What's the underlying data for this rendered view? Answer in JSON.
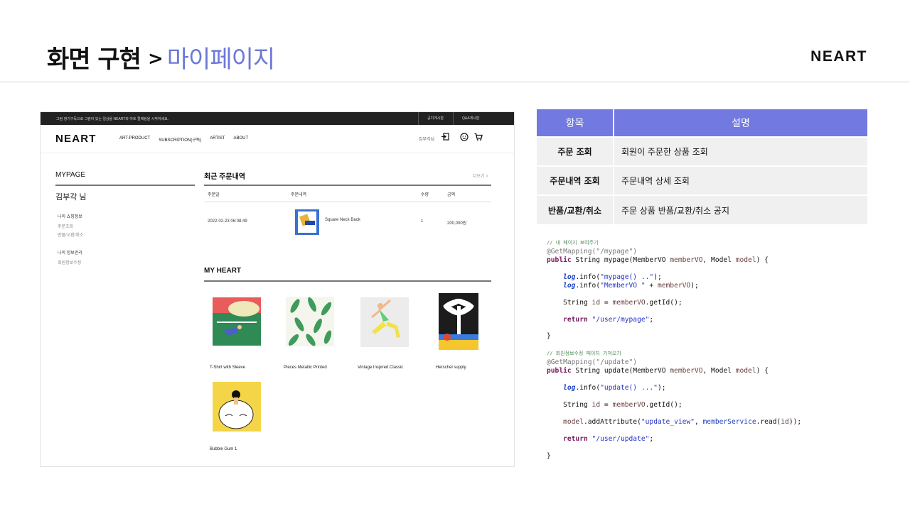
{
  "slide": {
    "title": "화면 구현",
    "arrow": ">",
    "subtitle": "마이페이지",
    "logo": "NEART",
    "accent": "#7279e0"
  },
  "screenshot": {
    "topbar": {
      "message": "그림 정기구독으로 그림이 있는 일상을 NEART와 아트 컬렉팅을 시작하세요.",
      "links": [
        "공지게시판",
        "Q&A게시판"
      ]
    },
    "nav": {
      "logo": "NEART",
      "menu": [
        "ART-PRODUCT",
        "SUBSCRIPTION(구독)",
        "ARTIST",
        "ABOUT"
      ],
      "user": "김부각님",
      "icons": [
        "logout-icon",
        "smile-icon",
        "cart-icon"
      ]
    },
    "sidebar": {
      "title": "MYPAGE",
      "greeting": "김부각 님",
      "shopping_head": "나의 쇼핑정보",
      "shopping_links": [
        "주문조회",
        "반품/교환/취소"
      ],
      "info_head": "나의 정보관리",
      "info_links": [
        "회원정보수정"
      ]
    },
    "orders": {
      "title": "최근 주문내역",
      "more": "더보기 >",
      "headers": [
        "주문일",
        "주문내역",
        "수량",
        "금액"
      ],
      "rows": [
        {
          "date": "2022-02-23 06:08:49",
          "item": "Square Neck Back",
          "qty": "1",
          "price": "200,000원"
        }
      ]
    },
    "hearts": {
      "title": "MY HEART",
      "items": [
        {
          "name": "T-Shirt with Sleeve"
        },
        {
          "name": "Pieces Metallic Printed"
        },
        {
          "name": "Vintage Inspired Classic"
        },
        {
          "name": "Herschel supply"
        },
        {
          "name": "Bubble Gum 1"
        }
      ]
    }
  },
  "table": {
    "headers": [
      "항목",
      "설명"
    ],
    "rows": [
      {
        "key": "주문 조회",
        "value": "회원이 주문한 상품 조회"
      },
      {
        "key": "주문내역 조회",
        "value": "주문내역 상세 조회"
      },
      {
        "key": "반품/교환/취소",
        "value": "주문 상품 반품/교환/취소 공지"
      }
    ]
  },
  "code": {
    "c1": "// 내 페이지 보여주기",
    "a1": "@GetMapping(\"/mypage\")",
    "kw_public": "public",
    "sig1": " String mypage(MemberVO ",
    "p_vo": "memberVO",
    "sig_mid": ", Model ",
    "p_model": "model",
    "sig_end": ") {",
    "log": "log",
    "info_open": ".info(",
    "s_mypage": "\"mypage() ..\"",
    "s_membervo": "\"MemberVO \"",
    "plus": " + ",
    "close_semi": ");",
    "string_id": "String ",
    "v_id": "id",
    "assign": " = ",
    "getid": ".getId();",
    "kw_return": "return",
    "s_ret1": "\"/user/mypage\"",
    "semi": ";",
    "rbrace": "}",
    "c2": "// 회원정보수정 페이지 가져오기",
    "a2": "@GetMapping(\"/update\")",
    "sig2": " String update(MemberVO ",
    "s_update": "\"update() ...\"",
    "add_attr": ".addAttribute(",
    "s_view": "\"update_view\"",
    "comma": ", ",
    "svc": "memberService",
    "read": ".read(",
    "close2": "));",
    "s_ret2": "\"/user/update\""
  }
}
